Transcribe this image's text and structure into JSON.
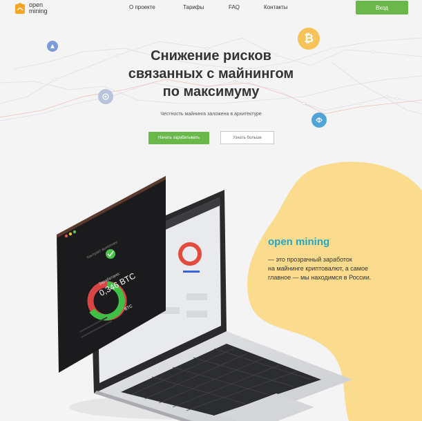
{
  "header": {
    "logo_line1": "open",
    "logo_line2": "mining",
    "nav": [
      "О проекте",
      "Тарифы",
      "FAQ",
      "Контакты"
    ],
    "login_label": "Вход"
  },
  "hero": {
    "title_line1": "Снижение рисков",
    "title_line2": "связанных с майнингом",
    "title_line3": "по максимуму",
    "subtitle": "Честность майнинга заложена в архитектуре",
    "start_button": "Начать зарабатывать",
    "more_button": "Узнать больше"
  },
  "promo": {
    "title": "open mining",
    "text_line1": "— это прозрачный заработок",
    "text_line2": "на майнинге криптовалют, а самое",
    "text_line3": "главное — мы находимся в России."
  },
  "widget": {
    "status": "Контракт выполнен",
    "earned_label": "Заработано:",
    "earned_value": "0,346 BTC",
    "donut_label": "BTC"
  },
  "colors": {
    "brand_green": "#6bb84a",
    "accent_blue": "#21a7c6",
    "blob_yellow": "#fbdb8e",
    "logo_orange": "#f5a623"
  },
  "icons": [
    "logo-icon",
    "bitcoin-icon",
    "coin-icon",
    "check-icon"
  ]
}
